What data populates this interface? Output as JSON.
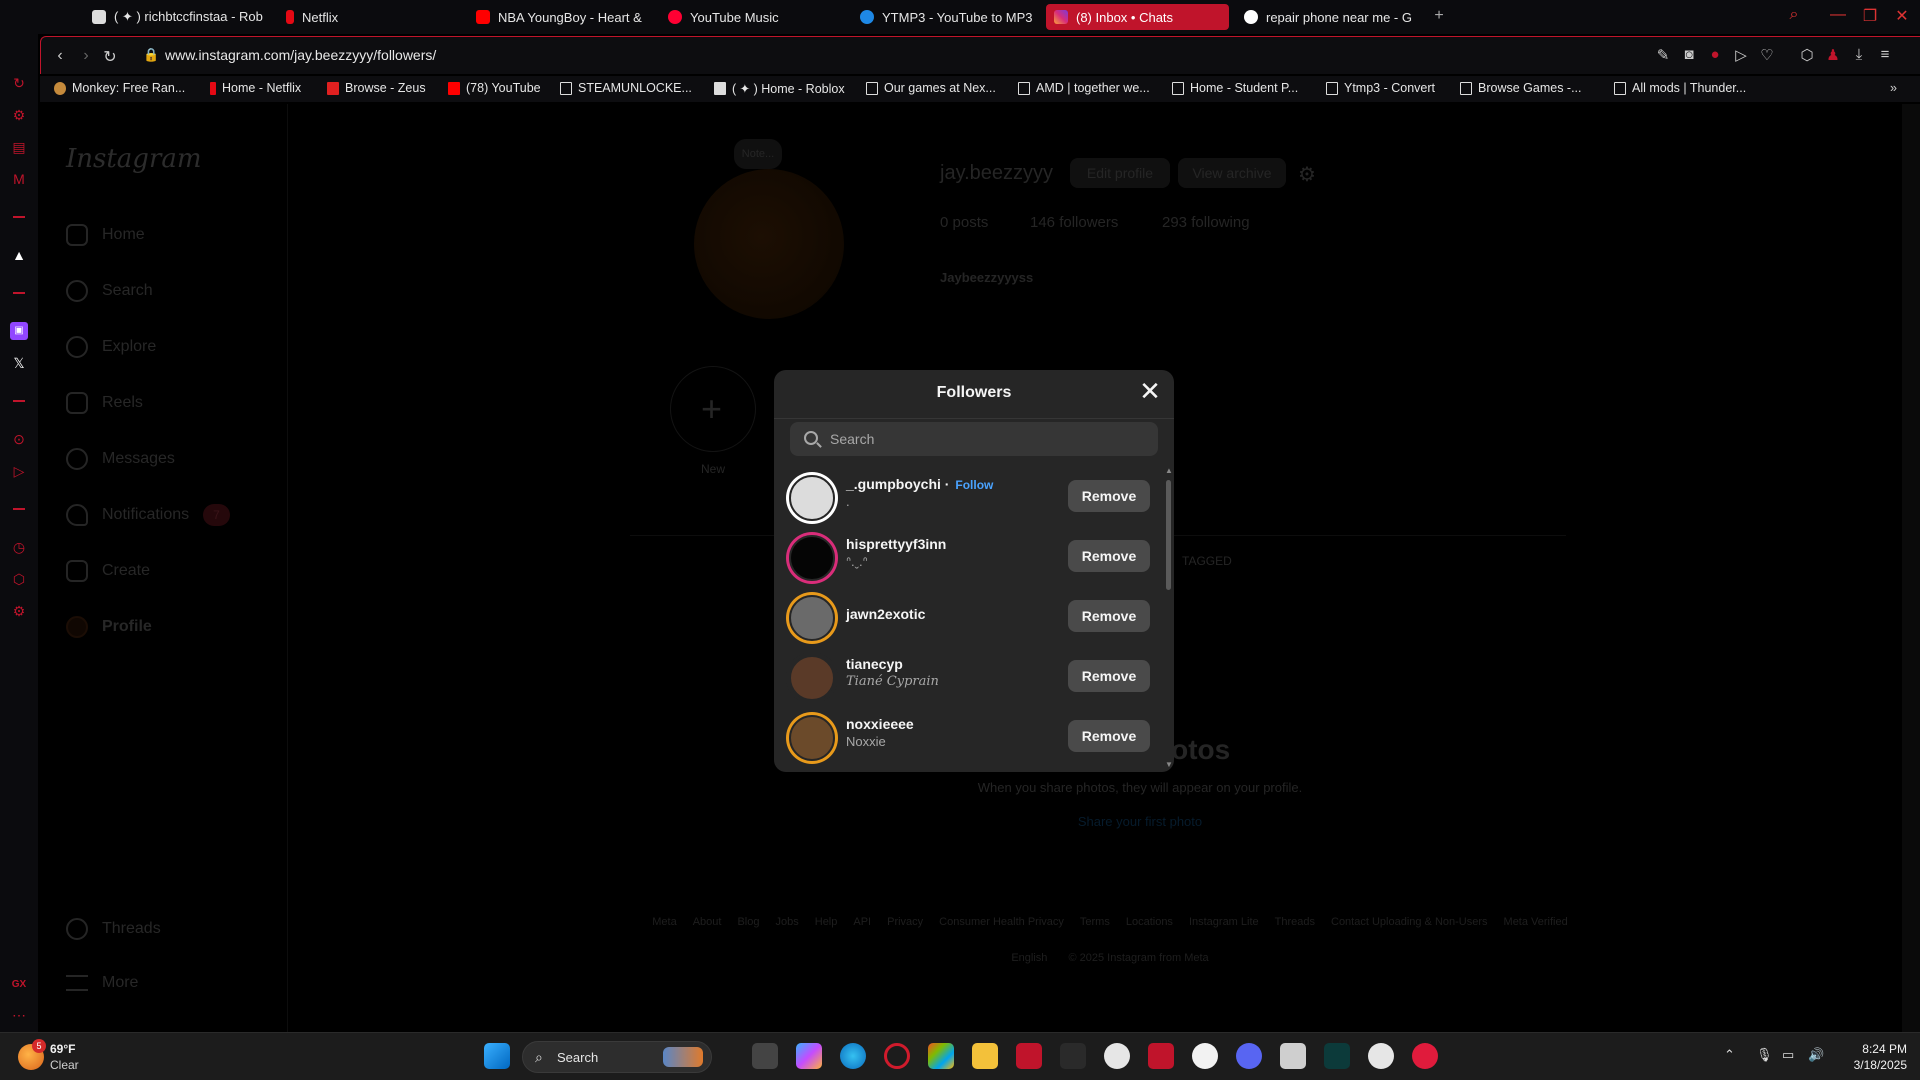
{
  "colors": {
    "accent": "#c0142b",
    "modal_bg": "#262626",
    "link": "#4aa3ff"
  },
  "browser": {
    "tabs": [
      {
        "label": "( ✦ ) richbtccfinstaa - Rob",
        "icon": "roblox-icon"
      },
      {
        "label": "Netflix",
        "icon": "netflix-icon"
      },
      {
        "label": "NBA YoungBoy - Heart &",
        "icon": "youtube-icon"
      },
      {
        "label": "YouTube Music",
        "icon": "youtube-music-icon"
      },
      {
        "label": "YTMP3 - YouTube to MP3",
        "icon": "ytmp3-icon"
      },
      {
        "label": "(8) Inbox • Chats",
        "icon": "instagram-icon",
        "active": true
      },
      {
        "label": "repair phone near me - G",
        "icon": "google-icon"
      }
    ],
    "url": "www.instagram.com/jay.beezzyyy/followers/",
    "bookmarks": [
      "Monkey: Free Ran...",
      "Home - Netflix",
      "Browse - Zeus",
      "(78) YouTube",
      "STEAMUNLOCKE...",
      "( ✦ ) Home - Roblox",
      "Our games at Nex...",
      "AMD | together we...",
      "Home - Student P...",
      "Ytmp3 - Convert",
      "Browse Games -...",
      "All mods | Thunder..."
    ]
  },
  "instagram": {
    "logo": "Instagram",
    "nav": [
      "Home",
      "Search",
      "Explore",
      "Reels",
      "Messages",
      "Notifications",
      "Create",
      "Profile"
    ],
    "nav_bottom": [
      "Threads",
      "More"
    ],
    "notifications_badge": "7",
    "profile": {
      "username": "jay.beezzyyy",
      "edit_profile": "Edit profile",
      "view_archive": "View archive",
      "posts": "0 posts",
      "followers": "146 followers",
      "following": "293 following",
      "display_name": "Jaybeezzyyyss",
      "note": "Note...",
      "new_label": "New",
      "tagged": "TAGGED",
      "no_posts_title": "Share Photos",
      "no_posts_text": "When you share photos, they will appear on your profile.",
      "share_first": "Share your first photo"
    },
    "footer_links": [
      "Meta",
      "About",
      "Blog",
      "Jobs",
      "Help",
      "API",
      "Privacy",
      "Consumer Health Privacy",
      "Terms",
      "Locations",
      "Instagram Lite",
      "Threads",
      "Contact Uploading & Non-Users",
      "Meta Verified"
    ],
    "footer_lang": "English",
    "footer_copy": "© 2025 Instagram from Meta"
  },
  "modal": {
    "title": "Followers",
    "search_placeholder": "Search",
    "follow_label": "Follow",
    "remove_label": "Remove",
    "followers": [
      {
        "username": "_.gumpboychi",
        "full_name": ".",
        "show_follow": true,
        "ring": "#ffffff",
        "avatar": "#dcdcdc"
      },
      {
        "username": "hisprettyyf3inn",
        "full_name": "ᐢ⁠.⁠ˬ⁠.⁠ᐢ",
        "show_follow": false,
        "ring": "#d92d7a",
        "avatar": "#050505"
      },
      {
        "username": "jawn2exotic",
        "full_name": "",
        "show_follow": false,
        "ring": "#e89a1b",
        "avatar": "#6a6a6a"
      },
      {
        "username": "tianecyp",
        "full_name": "Tiané Cyprain",
        "show_follow": false,
        "ring": "#262626",
        "avatar": "#5a3a28"
      },
      {
        "username": "noxxieeee",
        "full_name": "Noxxie",
        "show_follow": false,
        "ring": "#e89a1b",
        "avatar": "#6b4a2a"
      }
    ]
  },
  "taskbar": {
    "weather_temp": "69°F",
    "weather_cond": "Clear",
    "weather_badge": "5",
    "search_label": "Search",
    "time": "8:24 PM",
    "date": "3/18/2025"
  }
}
